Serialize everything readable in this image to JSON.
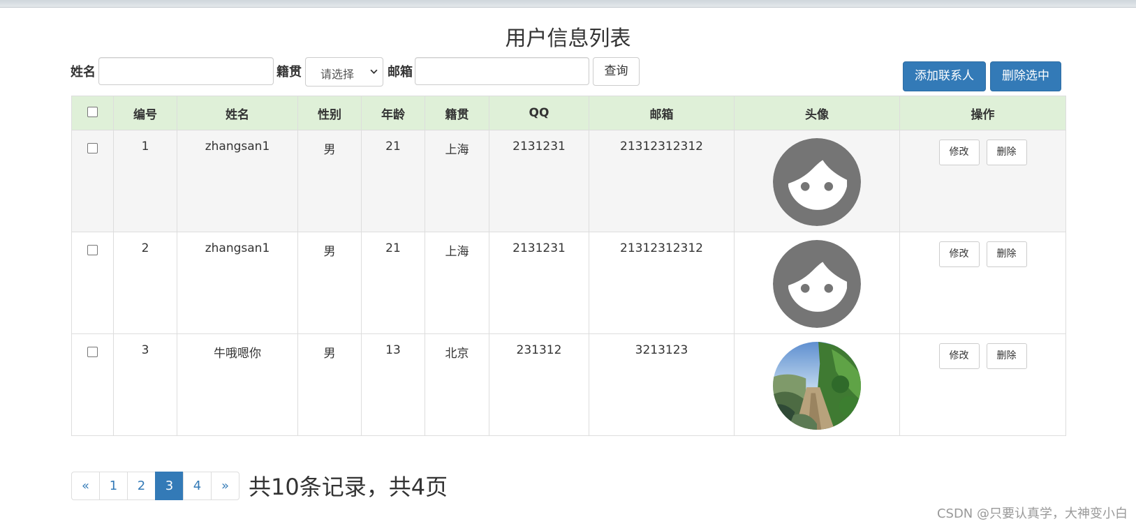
{
  "page_title": "用户信息列表",
  "search": {
    "name_label": "姓名",
    "name_value": "",
    "native_label": "籍贯",
    "native_selected": "请选择",
    "email_label": "邮箱",
    "email_value": "",
    "query_button": "查询"
  },
  "actions": {
    "add_button": "添加联系人",
    "delete_selected_button": "删除选中"
  },
  "table": {
    "headers": {
      "id": "编号",
      "name": "姓名",
      "gender": "性别",
      "age": "年龄",
      "native": "籍贯",
      "qq": "QQ",
      "email": "邮箱",
      "avatar": "头像",
      "ops": "操作"
    },
    "rows": [
      {
        "id": "1",
        "name": "zhangsan1",
        "gender": "男",
        "age": "21",
        "native": "上海",
        "qq": "2131231",
        "email": "21312312312",
        "avatar": "default-face-avatar",
        "edit": "修改",
        "delete": "删除"
      },
      {
        "id": "2",
        "name": "zhangsan1",
        "gender": "男",
        "age": "21",
        "native": "上海",
        "qq": "2131231",
        "email": "21312312312",
        "avatar": "default-face-avatar",
        "edit": "修改",
        "delete": "删除"
      },
      {
        "id": "3",
        "name": "牛哦嗯你",
        "gender": "男",
        "age": "13",
        "native": "北京",
        "qq": "231312",
        "email": "3213123",
        "avatar": "landscape-photo-avatar",
        "edit": "修改",
        "delete": "删除"
      }
    ]
  },
  "pagination": {
    "prev": "«",
    "pages": [
      "1",
      "2",
      "3",
      "4"
    ],
    "current_page": "3",
    "next": "»",
    "summary": "共10条记录，共4页"
  },
  "watermark": "CSDN @只要认真学，大神变小白",
  "colors": {
    "primary": "#337ab7",
    "header_bg": "#dff0d8",
    "striped_row": "#f5f5f5",
    "avatar_gray": "#757575"
  }
}
